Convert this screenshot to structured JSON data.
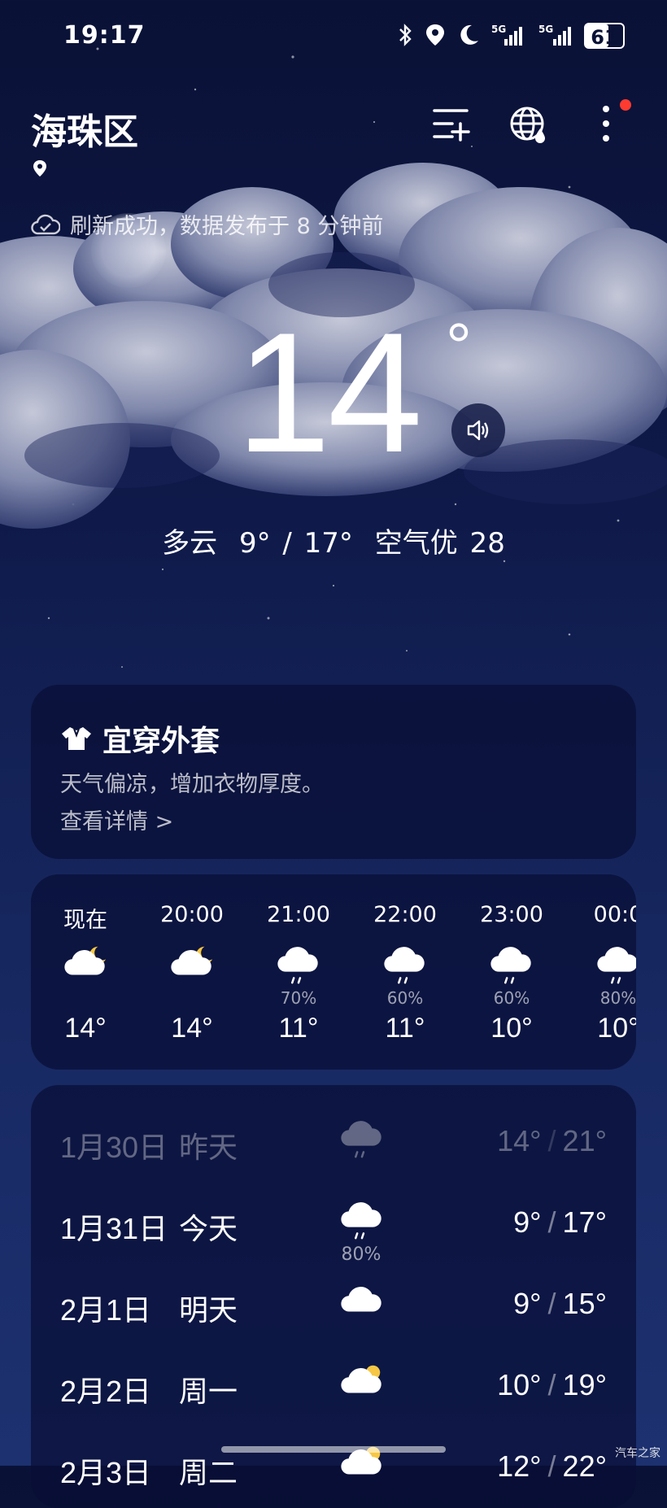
{
  "status_bar": {
    "time": "19:17",
    "battery": "61",
    "signal_labels": [
      "5G",
      "5G"
    ]
  },
  "header": {
    "location": "海珠区",
    "refresh_text": "刷新成功，数据发布于 8 分钟前"
  },
  "current": {
    "temperature": "14",
    "degree": "°",
    "condition": "多云",
    "range": "9° / 17°",
    "air_quality": "空气优 28"
  },
  "dress": {
    "title": "宜穿外套",
    "description": "天气偏凉，增加衣物厚度。",
    "link": "查看详情 >"
  },
  "hourly": [
    {
      "label": "现在",
      "icon": "partly-cloudy-night-icon",
      "precip": "",
      "temp": "14°"
    },
    {
      "label": "20:00",
      "icon": "partly-cloudy-night-icon",
      "precip": "",
      "temp": "14°"
    },
    {
      "label": "21:00",
      "icon": "rain-cloud-icon",
      "precip": "70%",
      "temp": "11°"
    },
    {
      "label": "22:00",
      "icon": "rain-cloud-icon",
      "precip": "60%",
      "temp": "11°"
    },
    {
      "label": "23:00",
      "icon": "rain-cloud-icon",
      "precip": "60%",
      "temp": "10°"
    },
    {
      "label": "00:0",
      "icon": "rain-cloud-icon",
      "precip": "80%",
      "temp": "10°"
    }
  ],
  "daily": [
    {
      "date": "1月30日",
      "name": "昨天",
      "icon": "rain-cloud-icon",
      "precip": "",
      "low": "14°",
      "high": "21°",
      "past": true
    },
    {
      "date": "1月31日",
      "name": "今天",
      "icon": "rain-cloud-icon",
      "precip": "80%",
      "low": "9°",
      "high": "17°",
      "past": false
    },
    {
      "date": "2月1日",
      "name": "明天",
      "icon": "cloud-icon",
      "precip": "",
      "low": "9°",
      "high": "15°",
      "past": false
    },
    {
      "date": "2月2日",
      "name": "周一",
      "icon": "partly-cloudy-day-icon",
      "precip": "",
      "low": "10°",
      "high": "19°",
      "past": false
    },
    {
      "date": "2月3日",
      "name": "周二",
      "icon": "partly-cloudy-day-icon",
      "precip": "",
      "low": "12°",
      "high": "22°",
      "past": false
    }
  ],
  "watermark": "汽车之家",
  "colors": {
    "background_top": "#0a1136",
    "background_bottom": "#1d3170",
    "card": "#080e34",
    "sun": "#f6c744",
    "badge_red": "#ff3b30"
  }
}
